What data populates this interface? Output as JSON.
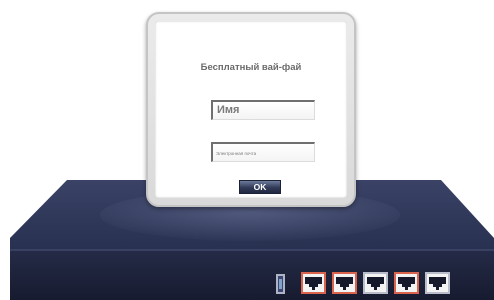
{
  "popup": {
    "title": "Бесплатный вай-фай",
    "name_placeholder": "Имя",
    "email_placeholder": "Электронная почта",
    "ok_label": "OK"
  },
  "device": {
    "body_color": "#2b3354",
    "front_color": "#1b2039",
    "port_highlight_color": "#d9634d",
    "port_count": 5,
    "highlighted_ports": [
      0,
      1,
      3
    ]
  }
}
